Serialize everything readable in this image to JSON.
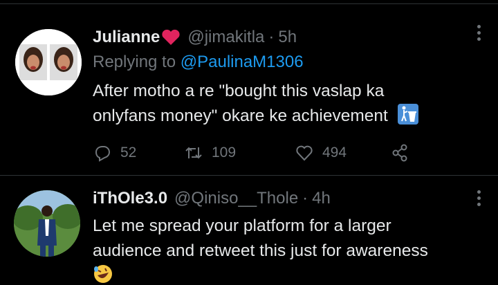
{
  "tweets": [
    {
      "display_name": "Julianne",
      "badge_icon": "red-heart-icon",
      "handle": "@jimakitla",
      "separator": "·",
      "time": "5h",
      "replying_prefix": "Replying to",
      "replying_to": "@PaulinaM1306",
      "text_line1": "After motho a re \"bought this vaslap ka",
      "text_line2": "onlyfans money\" okare ke achievement",
      "trailing_emoji": "put-litter-in-bin-icon",
      "replies": "52",
      "retweets": "109",
      "likes": "494"
    },
    {
      "display_name": "iThOle3.0",
      "handle": "@Qiniso__Thole",
      "separator": "·",
      "time": "4h",
      "text_line1": "Let me spread your platform for a larger",
      "text_line2": "audience and retweet this just for awareness",
      "trailing_emoji": "rolling-on-floor-laughing-icon"
    }
  ],
  "colors": {
    "background": "#000000",
    "text_primary": "#e7e9ea",
    "text_secondary": "#71767b",
    "accent": "#1d9bf0",
    "heart": "#e0245e"
  }
}
